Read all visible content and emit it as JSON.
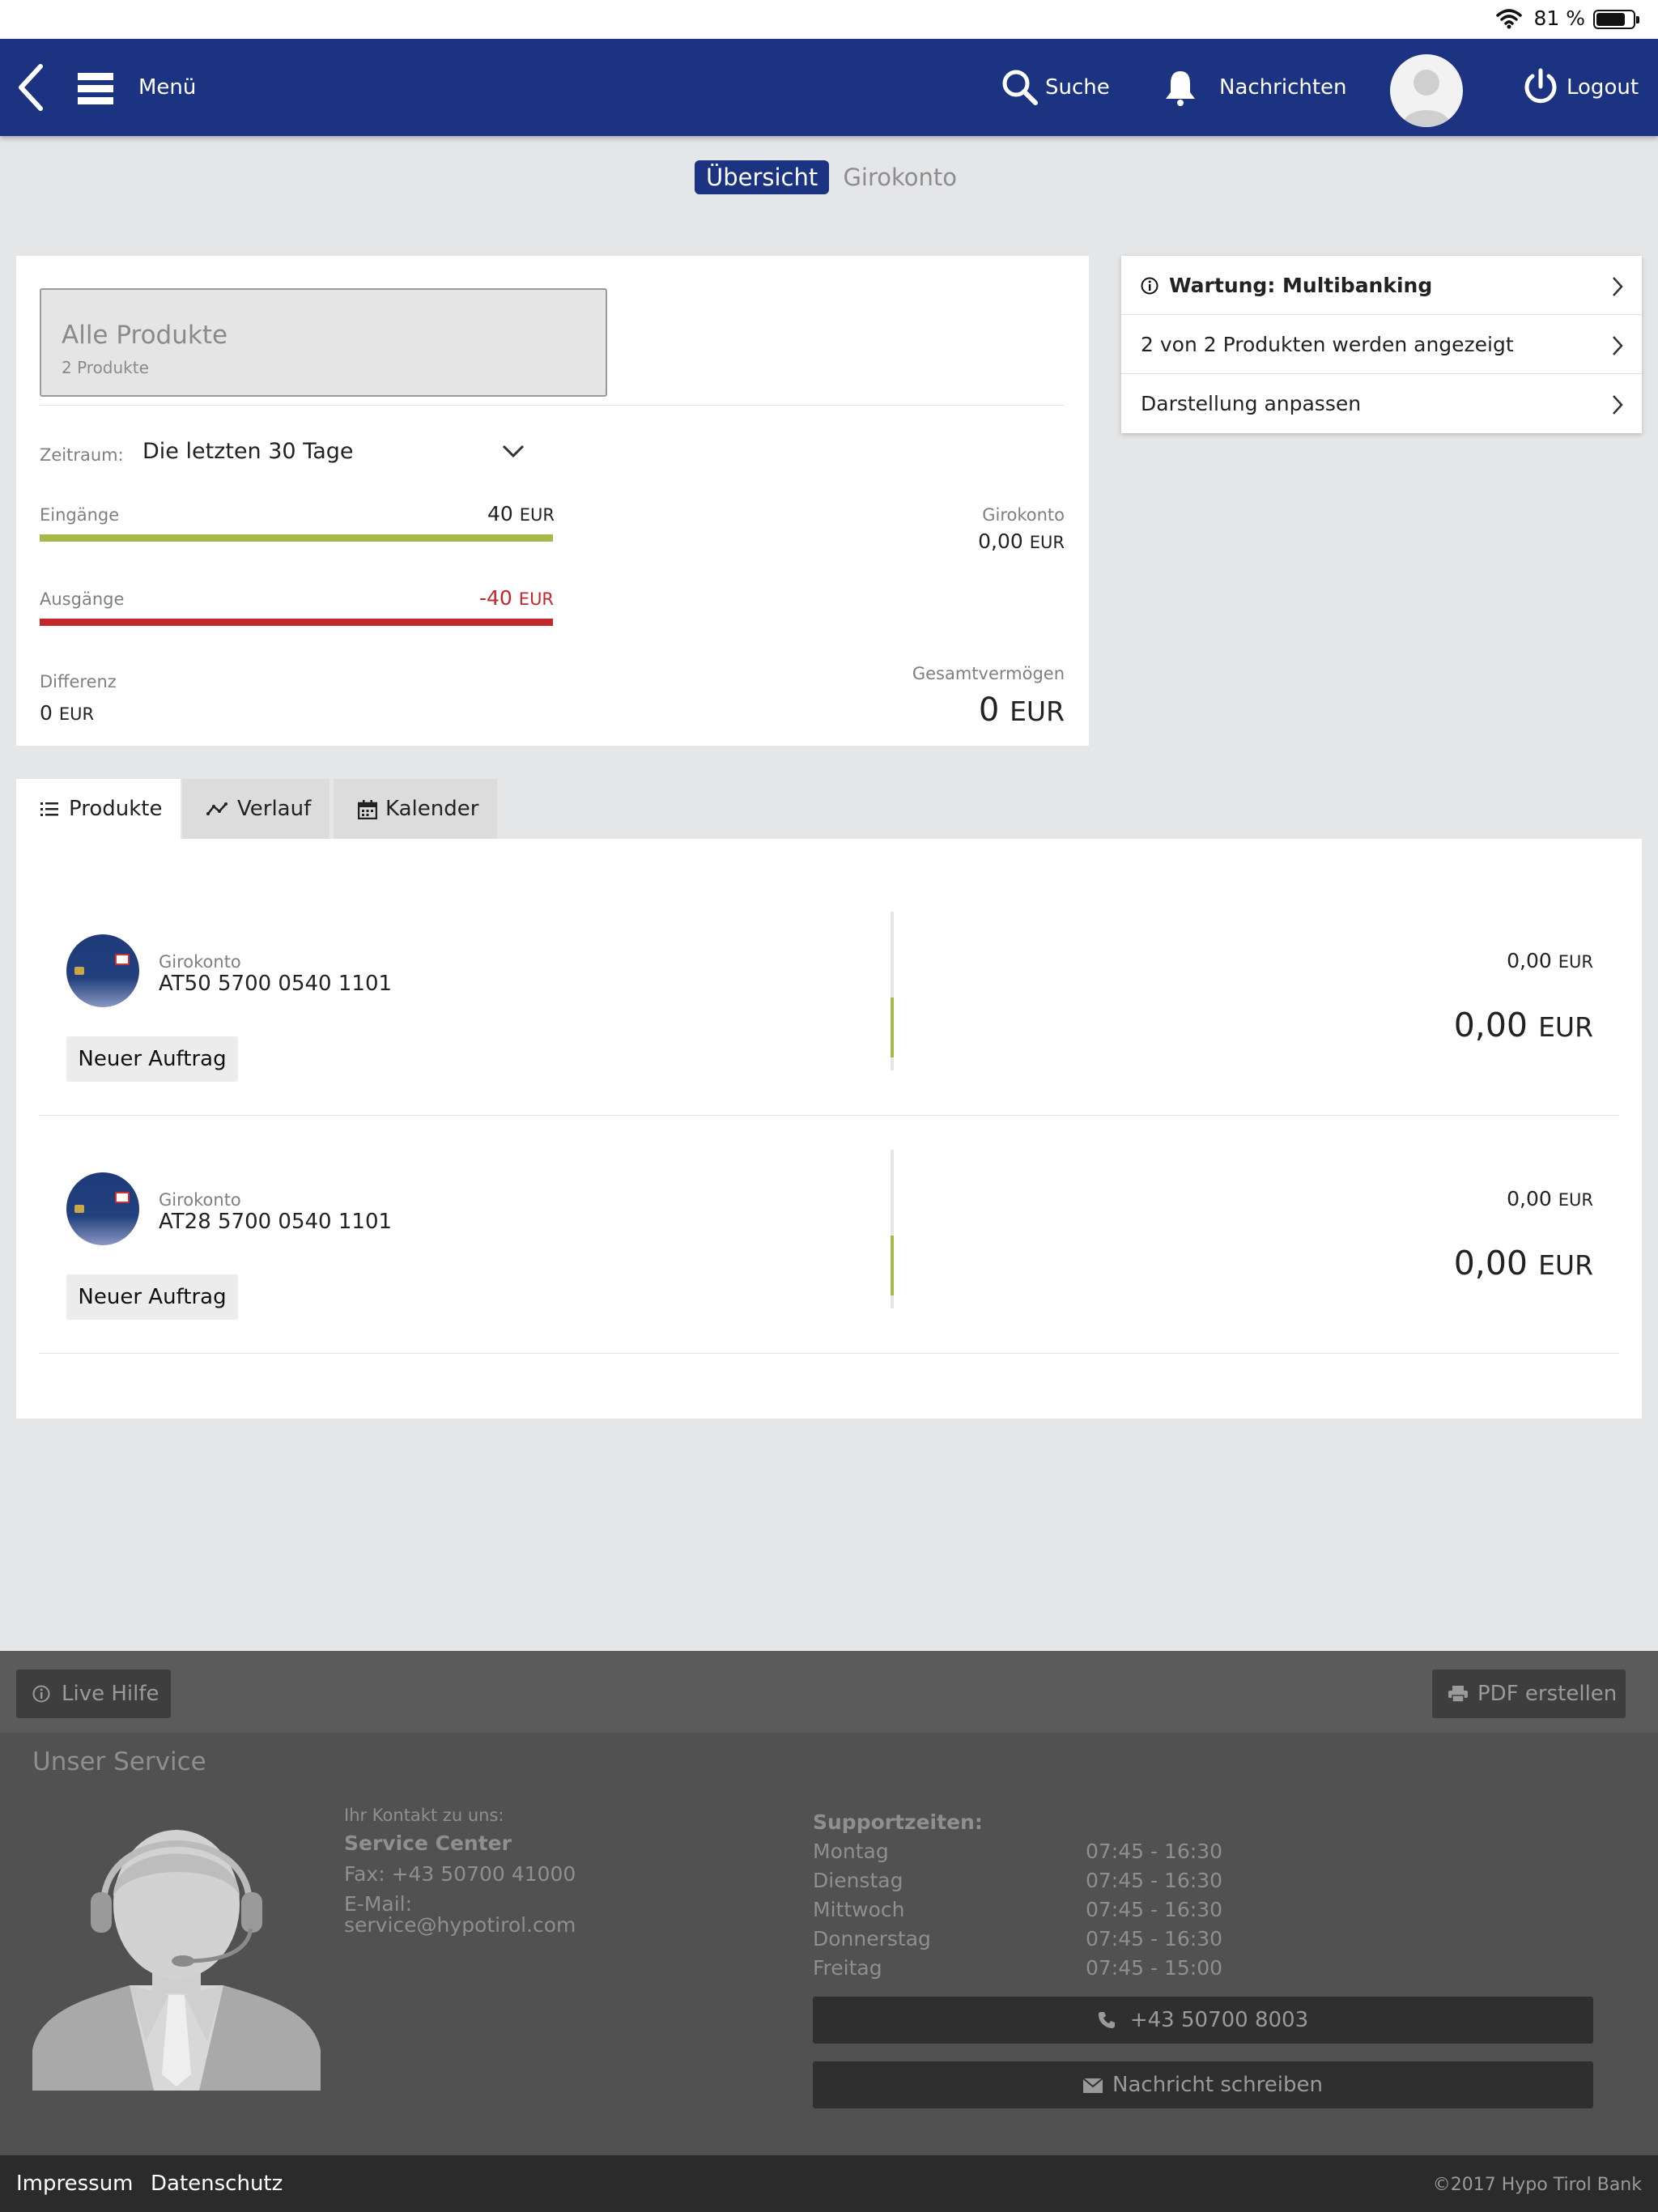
{
  "status_bar": {
    "battery_text": "81 %",
    "battery_level": 0.81
  },
  "header": {
    "menu_label": "Menü",
    "search_label": "Suche",
    "notifications_label": "Nachrichten",
    "logout_label": "Logout"
  },
  "top_tabs": {
    "active": "Übersicht",
    "inactive": "Girokonto"
  },
  "summary": {
    "product_select_title": "Alle Produkte",
    "product_select_sub": "2 Produkte",
    "period_label": "Zeitraum:",
    "period_value": "Die letzten 30 Tage",
    "income_label": "Eingänge",
    "income_value": "40",
    "income_currency": "EUR",
    "expense_label": "Ausgänge",
    "expense_value": "-40",
    "expense_currency": "EUR",
    "account_label": "Girokonto",
    "account_value": "0,00",
    "account_currency": "EUR",
    "diff_label": "Differenz",
    "diff_value": "0",
    "diff_currency": "EUR",
    "total_label": "Gesamtvermögen",
    "total_value": "0",
    "total_currency": "EUR",
    "colors": {
      "income": "#a7b84a",
      "expense": "#c3272b"
    }
  },
  "right_panel": {
    "items": [
      {
        "label": "Wartung: Multibanking"
      },
      {
        "label": "2 von 2 Produkten werden angezeigt"
      },
      {
        "label": "Darstellung anpassen"
      }
    ]
  },
  "tabs": [
    {
      "label": "Produkte",
      "icon": "list-icon"
    },
    {
      "label": "Verlauf",
      "icon": "chart-line-icon"
    },
    {
      "label": "Kalender",
      "icon": "calendar-icon"
    }
  ],
  "accounts": [
    {
      "type": "Girokonto",
      "iban": "AT50 5700 0540 1101",
      "button": "Neuer Auftrag",
      "small_value": "0,00",
      "small_currency": "EUR",
      "big_value": "0,00",
      "big_currency": "EUR"
    },
    {
      "type": "Girokonto",
      "iban": "AT28 5700 0540 1101",
      "button": "Neuer Auftrag",
      "small_value": "0,00",
      "small_currency": "EUR",
      "big_value": "0,00",
      "big_currency": "EUR"
    }
  ],
  "footer": {
    "live_help": "Live Hilfe",
    "pdf": "PDF erstellen",
    "service_title": "Unser Service",
    "contact_label": "Ihr Kontakt zu uns:",
    "service_center": "Service Center",
    "fax": "Fax: +43 50700 41000",
    "email_label": "E-Mail:",
    "email": "service@hypotirol.com",
    "support_title": "Supportzeiten:",
    "hours": [
      {
        "day": "Montag",
        "time": "07:45 - 16:30"
      },
      {
        "day": "Dienstag",
        "time": "07:45 - 16:30"
      },
      {
        "day": "Mittwoch",
        "time": "07:45 - 16:30"
      },
      {
        "day": "Donnerstag",
        "time": "07:45 - 16:30"
      },
      {
        "day": "Freitag",
        "time": "07:45 - 15:00"
      }
    ],
    "phone": "+43 50700 8003",
    "message": "Nachricht schreiben",
    "impressum": "Impressum",
    "datenschutz": "Datenschutz",
    "copyright": "©2017 Hypo Tirol Bank"
  }
}
